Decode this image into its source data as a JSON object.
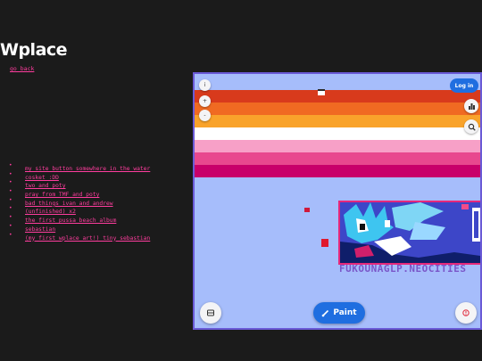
{
  "logo": {
    "text": "Wplace"
  },
  "back_link": "go back",
  "links": [
    "my site button somewhere in the water",
    "cosket :DD",
    "two and poty",
    "pray from TMF and poty",
    "bad things ivan and andrew",
    "(unfinished) x2",
    "the first pussa beach album",
    "sebastian",
    "(my first wplace art!) tiny sebastian"
  ],
  "embed": {
    "info_icon_glyph": "i",
    "zoom_in_glyph": "+",
    "zoom_out_glyph": "-",
    "login_label": "Log in",
    "paint_label": "Paint",
    "art_caption": "FUKOUNAGLP.NEOCITIES",
    "stripe_colors": [
      "#d83a1c",
      "#f06a22",
      "#f9a32b",
      "#ffffff",
      "#f7a0c7",
      "#e8488e",
      "#c8006a"
    ],
    "map_color": "#a6bdfb",
    "border_color": "#6a5ad6",
    "accent_color": "#1f6ee0"
  },
  "colors": {
    "background": "#1b1b1b",
    "link": "#ff3d9e",
    "logo": "#ffffff"
  }
}
